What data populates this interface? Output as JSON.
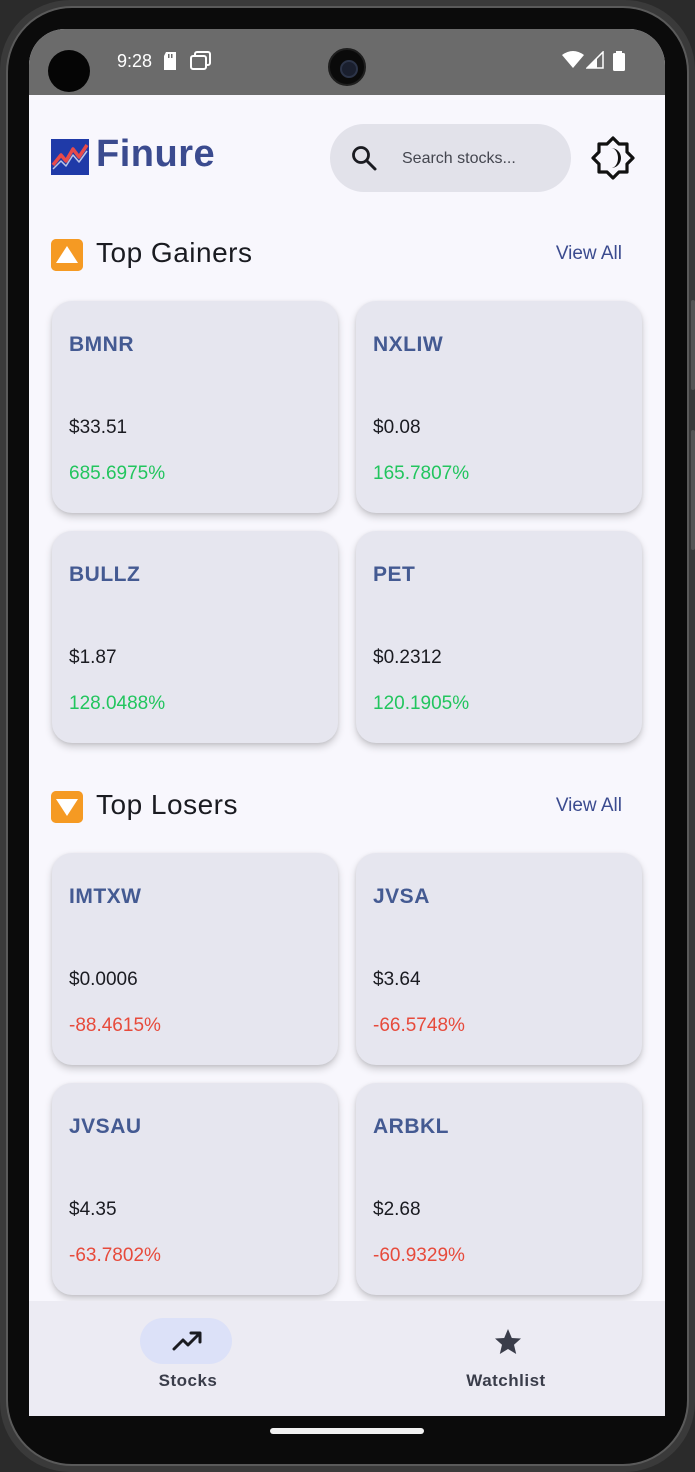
{
  "status_bar": {
    "time": "9:28"
  },
  "header": {
    "app_title": "Finure",
    "search_placeholder": "Search stocks...",
    "theme_icon": "brightness-icon"
  },
  "sections": {
    "gainers": {
      "title": "Top Gainers",
      "view_all": "View All",
      "icon": "up-triangle-icon",
      "cards": [
        {
          "symbol": "BMNR",
          "price": "$33.51",
          "change": "685.6975%"
        },
        {
          "symbol": "NXLIW",
          "price": "$0.08",
          "change": "165.7807%"
        },
        {
          "symbol": "BULLZ",
          "price": "$1.87",
          "change": "128.0488%"
        },
        {
          "symbol": "PET",
          "price": "$0.2312",
          "change": "120.1905%"
        }
      ]
    },
    "losers": {
      "title": "Top Losers",
      "view_all": "View All",
      "icon": "down-triangle-icon",
      "cards": [
        {
          "symbol": "IMTXW",
          "price": "$0.0006",
          "change": "-88.4615%"
        },
        {
          "symbol": "JVSA",
          "price": "$3.64",
          "change": "-66.5748%"
        },
        {
          "symbol": "JVSAU",
          "price": "$4.35",
          "change": "-63.7802%"
        },
        {
          "symbol": "ARBKL",
          "price": "$2.68",
          "change": "-60.9329%"
        }
      ]
    }
  },
  "bottom_nav": {
    "items": [
      {
        "label": "Stocks",
        "icon": "trending-up-icon",
        "active": true
      },
      {
        "label": "Watchlist",
        "icon": "star-icon",
        "active": false
      }
    ]
  },
  "colors": {
    "brand": "#3b4b8f",
    "gain": "#22c55e",
    "loss": "#e74a3b",
    "accent_orange": "#f59a23"
  }
}
